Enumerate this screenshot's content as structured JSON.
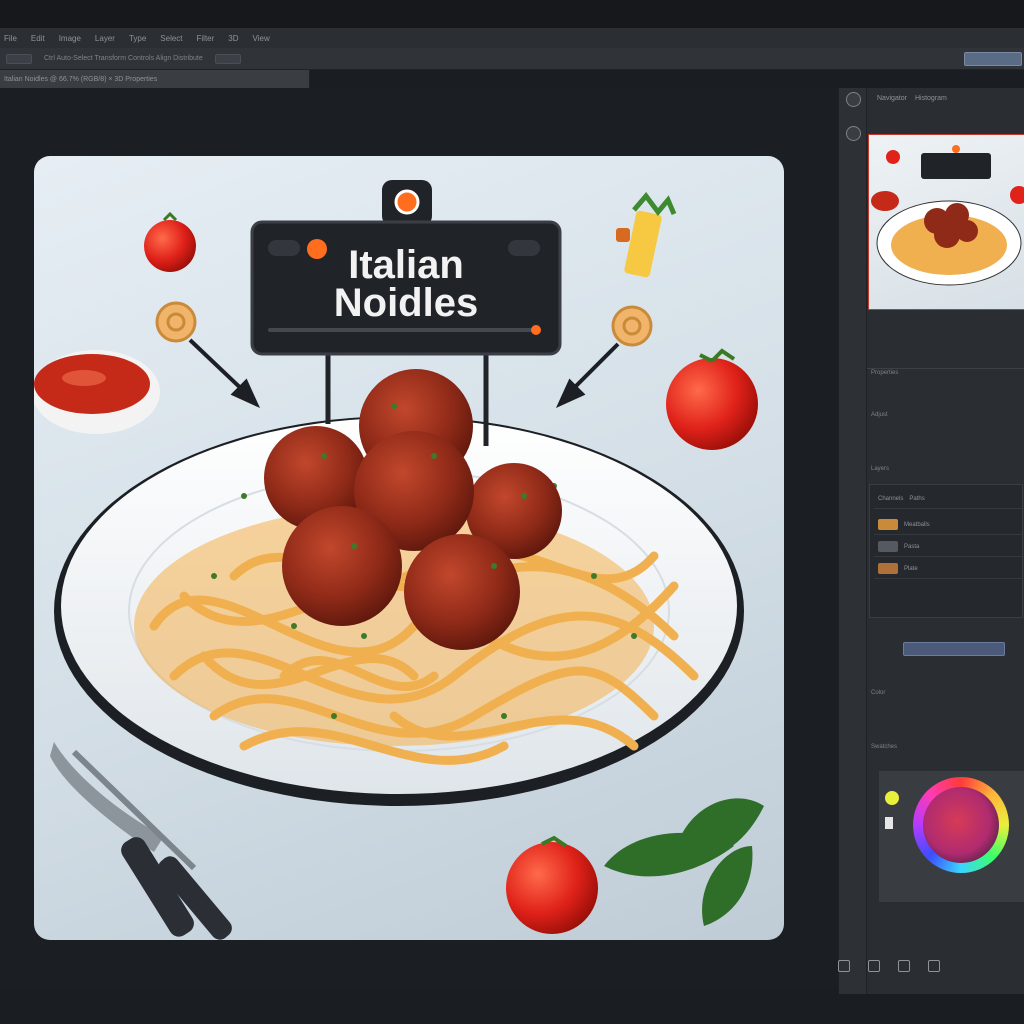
{
  "app": {
    "menu": [
      "File",
      "Edit",
      "Image",
      "Layer",
      "Type",
      "Select",
      "Filter",
      "3D",
      "View"
    ],
    "options_text": "Ctrl  Auto-Select  Transform Controls  Align  Distribute",
    "doc_tab": "Italian Noidles @ 66.7% (RGB/8)  ×  3D  Properties"
  },
  "canvas": {
    "sign_line1": "Italian",
    "sign_line2": "Noidles"
  },
  "panel": {
    "tabs": [
      "Navigator",
      "Histogram"
    ],
    "sections": {
      "properties": "Properties",
      "adjust": "Adjust",
      "layers": "Layers",
      "channels": "Channels",
      "paths": "Paths",
      "color": "Color",
      "swatches": "Swatches"
    },
    "layers": [
      "Meatballs",
      "Pasta",
      "Plate"
    ],
    "color_hex": "#d63b56"
  }
}
